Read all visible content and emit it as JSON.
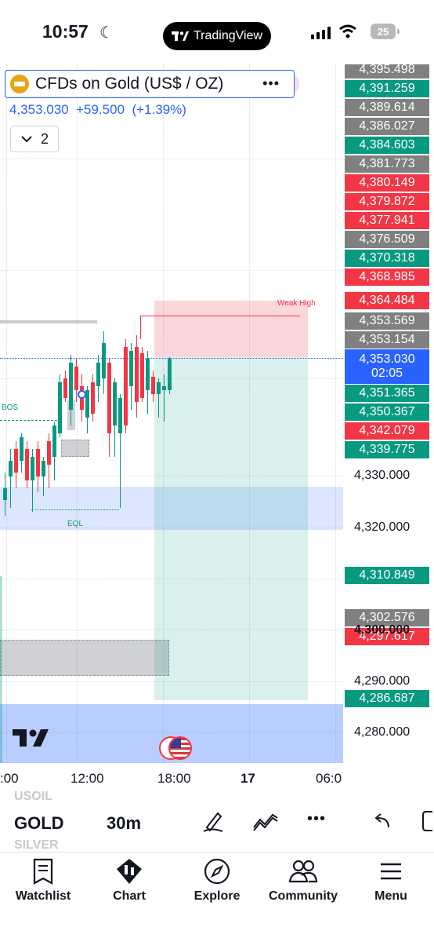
{
  "status_bar": {
    "time": "10:57",
    "app_name": "TradingView",
    "battery": "25"
  },
  "symbol": {
    "name": "CFDs on Gold (US$ / OZ)",
    "more": "•••",
    "price": "4,353.030",
    "change": "+59.500",
    "change_pct": "(+1.39%)",
    "collapsed_count": "2"
  },
  "annotations": {
    "bos": "BOS",
    "eql": "EQL",
    "weak_high": "Weak High"
  },
  "price_labels": [
    {
      "value": "4,395.498",
      "color": "#808080"
    },
    {
      "value": "4,391.259",
      "color": "#089981"
    },
    {
      "value": "4,389.614",
      "color": "#808080"
    },
    {
      "value": "4,386.027",
      "color": "#808080"
    },
    {
      "value": "4,384.603",
      "color": "#089981"
    },
    {
      "value": "4,381.773",
      "color": "#808080"
    },
    {
      "value": "4,380.149",
      "color": "#f23645"
    },
    {
      "value": "4,379.872",
      "color": "#f23645"
    },
    {
      "value": "4,377.941",
      "color": "#f23645"
    },
    {
      "value": "4,376.509",
      "color": "#808080"
    },
    {
      "value": "4,370.318",
      "color": "#089981"
    },
    {
      "value": "4,368.985",
      "color": "#f23645"
    },
    {
      "value": "4,364.484",
      "color": "#f23645"
    },
    {
      "value": "4,353.569",
      "color": "#808080"
    },
    {
      "value": "4,353.154",
      "color": "#808080"
    }
  ],
  "current_price": {
    "value": "4,353.030",
    "countdown": "02:05",
    "color": "#2962ff"
  },
  "price_labels_lower": [
    {
      "value": "4,351.365",
      "color": "#089981"
    },
    {
      "value": "4,350.367",
      "color": "#089981"
    },
    {
      "value": "4,342.079",
      "color": "#f23645"
    },
    {
      "value": "4,339.775",
      "color": "#089981"
    }
  ],
  "axis_prices": [
    "4,330.000",
    "4,320.000",
    "4,290.000",
    "4,280.000"
  ],
  "price_labels_bottom": [
    {
      "value": "4,310.849",
      "color": "#089981"
    },
    {
      "value": "4,302.576",
      "color": "#808080"
    },
    {
      "value": "4,297.617",
      "color": "#f23645"
    },
    {
      "value": "4,286.687",
      "color": "#089981"
    }
  ],
  "axis_price_hidden": "4,300.000",
  "time_labels": [
    ":00",
    "12:00",
    "18:00",
    "17",
    "06:0"
  ],
  "toolbar": {
    "symbols_above": "USOIL",
    "symbol_current": "GOLD",
    "symbols_below": "SILVER",
    "interval": "30m"
  },
  "nav": [
    "Watchlist",
    "Chart",
    "Explore",
    "Community",
    "Menu"
  ],
  "colors": {
    "up": "#089981",
    "down": "#f23645",
    "accent": "#2962ff"
  }
}
